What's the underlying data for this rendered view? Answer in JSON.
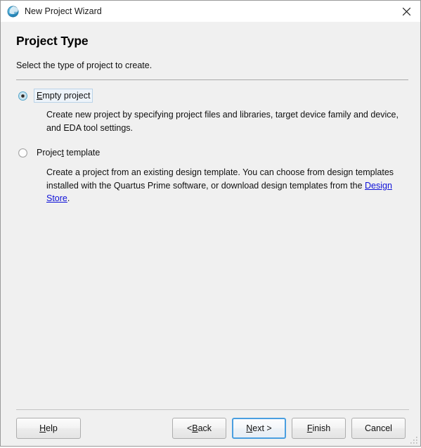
{
  "window": {
    "title": "New Project Wizard",
    "icon": "quartus-globe-icon",
    "close_label": "✕"
  },
  "page": {
    "heading": "Project Type",
    "subtitle": "Select the type of project to create."
  },
  "options": [
    {
      "id": "empty-project",
      "label_pre": "",
      "label_mnemonic": "E",
      "label_post": "mpty project",
      "selected": true,
      "focused": true,
      "description": "Create new project by specifying project files and libraries, target device family and device, and EDA tool settings."
    },
    {
      "id": "project-template",
      "label_pre": "Projec",
      "label_mnemonic": "t",
      "label_post": " template",
      "selected": false,
      "focused": false,
      "description_before_link": "Create a project from an existing design template. You can choose from design templates installed with the Quartus Prime software, or download design templates from the ",
      "link_text": "Design Store",
      "description_after_link": "."
    }
  ],
  "buttons": {
    "help": {
      "pre": "",
      "mnemonic": "H",
      "post": "elp"
    },
    "back": {
      "pre": "< ",
      "mnemonic": "B",
      "post": "ack"
    },
    "next": {
      "pre": "",
      "mnemonic": "N",
      "post": "ext >"
    },
    "finish": {
      "pre": "",
      "mnemonic": "F",
      "post": "inish"
    },
    "cancel": {
      "pre": "Cancel",
      "mnemonic": "",
      "post": ""
    }
  },
  "colors": {
    "window_background": "#f0f0f0",
    "titlebar_background": "#ffffff",
    "link": "#0e11d8",
    "focus_accent": "#4a9fe0",
    "border": "#9a9a9a",
    "radio_accent": "#3a9ec9"
  }
}
